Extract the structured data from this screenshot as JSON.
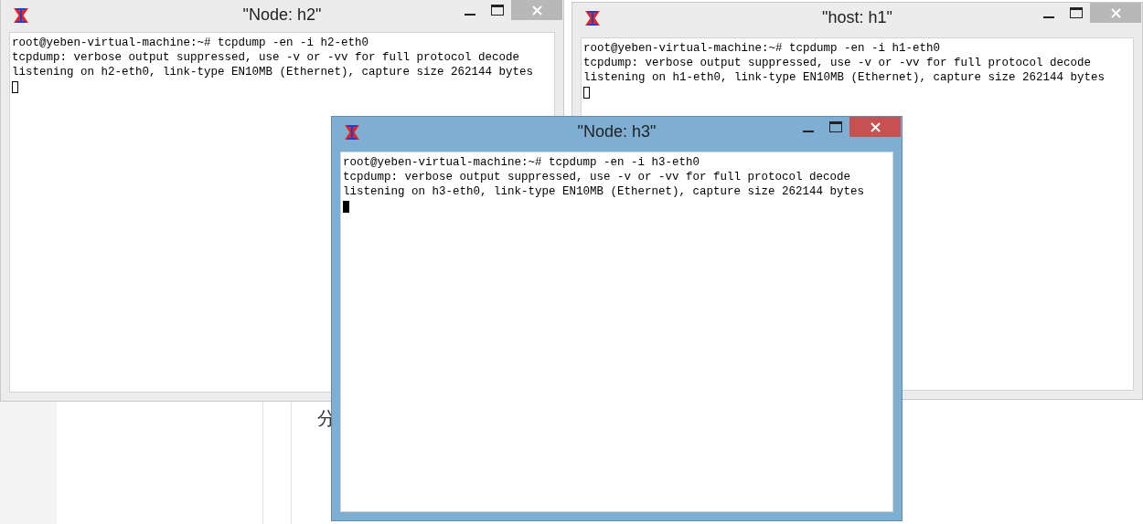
{
  "background": {
    "text": "分"
  },
  "windows": [
    {
      "title": "\"Node: h2\"",
      "active": false,
      "lines": [
        "root@yeben-virtual-machine:~# tcpdump -en -i h2-eth0",
        "tcpdump: verbose output suppressed, use -v or -vv for full protocol decode",
        "listening on h2-eth0, link-type EN10MB (Ethernet), capture size 262144 bytes"
      ]
    },
    {
      "title": "\"host: h1\"",
      "active": false,
      "lines": [
        "root@yeben-virtual-machine:~# tcpdump -en -i h1-eth0",
        "tcpdump: verbose output suppressed, use -v or -vv for full protocol decode",
        "listening on h1-eth0, link-type EN10MB (Ethernet), capture size 262144 bytes"
      ]
    },
    {
      "title": "\"Node: h3\"",
      "active": true,
      "lines": [
        "root@yeben-virtual-machine:~# tcpdump -en -i h3-eth0",
        "tcpdump: verbose output suppressed, use -v or -vv for full protocol decode",
        "listening on h3-eth0, link-type EN10MB (Ethernet), capture size 262144 bytes"
      ]
    }
  ]
}
